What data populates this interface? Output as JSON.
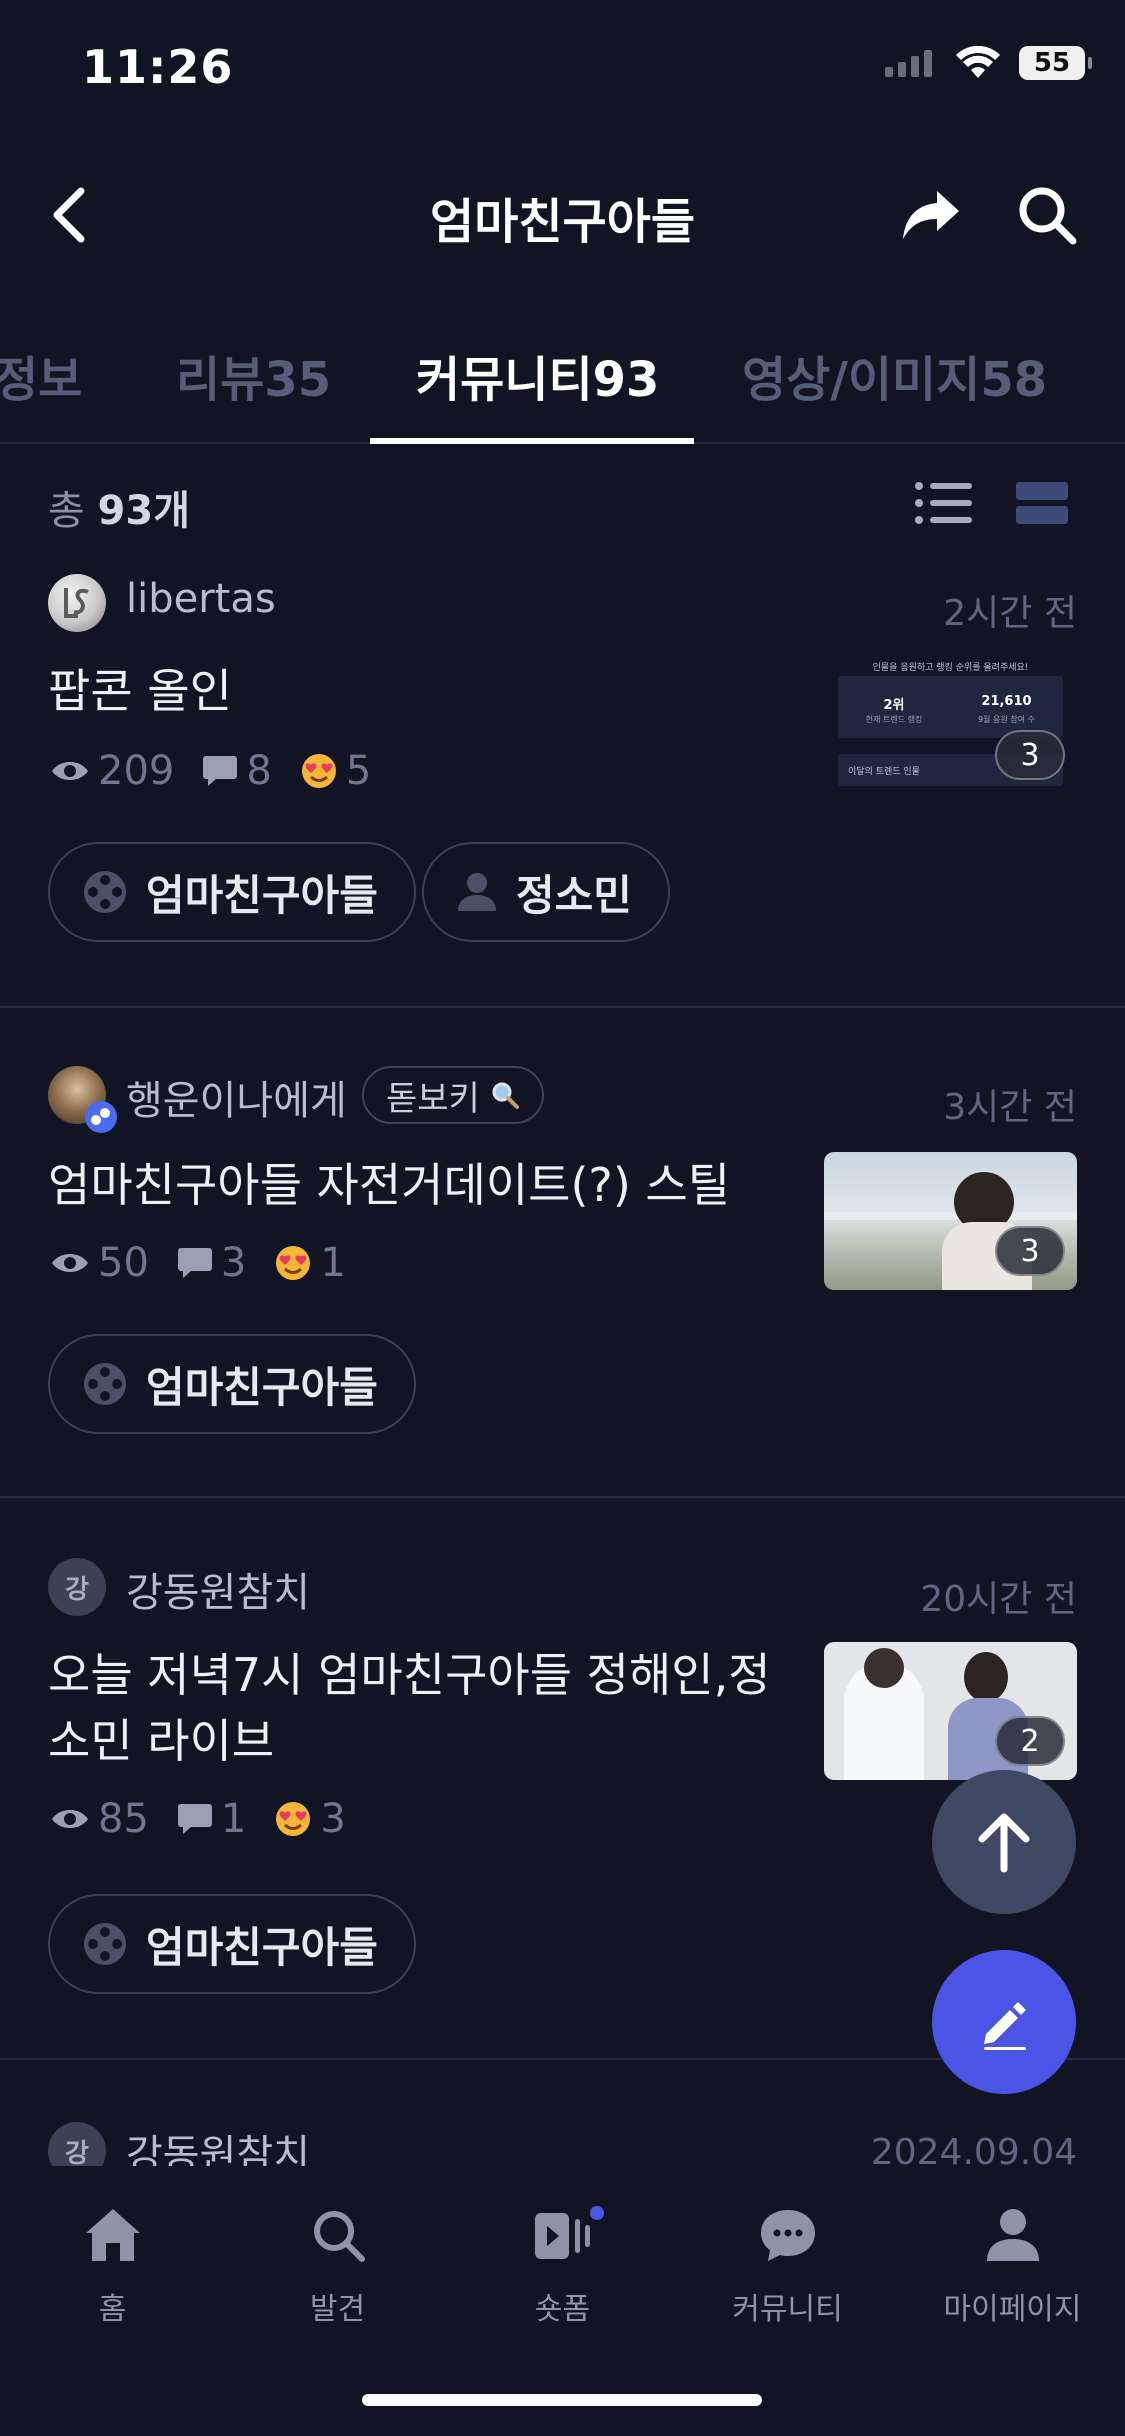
{
  "status_bar": {
    "time": "11:26",
    "battery": "55",
    "icons": [
      "signal-icon",
      "wifi-icon",
      "battery-icon"
    ]
  },
  "header": {
    "title": "엄마친구아들",
    "icons": [
      "back-icon",
      "share-icon",
      "search-icon"
    ]
  },
  "tabs": [
    {
      "label": "정보"
    },
    {
      "label": "리뷰35"
    },
    {
      "label": "커뮤니티93",
      "active": true
    },
    {
      "label": "영상/이미지58"
    }
  ],
  "list_header": {
    "prefix": "총",
    "count": "93개"
  },
  "posts": [
    {
      "author": "libertas",
      "time": "2시간 전",
      "title": "팝콘 올인",
      "views": "209",
      "comments": "8",
      "reactions": "5",
      "image_count": "3",
      "thumb_text": {
        "banner": "인물을 응원하고 랭킹 순위를 올려주세요!",
        "rank": "2위",
        "rank_sub": "현재 트렌드 랭킹",
        "votes": "21,610",
        "votes_sub": "9월 응원 참여 수",
        "footer": "이달의 트렌드 인물"
      },
      "tags": [
        {
          "label": "엄마친구아들",
          "icon": "film-reel-icon"
        },
        {
          "label": "정소민",
          "icon": "person-icon"
        }
      ]
    },
    {
      "author": "행운이나에게",
      "badge": "돋보키",
      "time": "3시간 전",
      "title": "엄마친구아들 자전거데이트(?) 스틸",
      "views": "50",
      "comments": "3",
      "reactions": "1",
      "image_count": "3",
      "tags": [
        {
          "label": "엄마친구아들",
          "icon": "film-reel-icon"
        }
      ]
    },
    {
      "author": "강동원참치",
      "avatar_initial": "강",
      "time": "20시간 전",
      "title": "오늘 저녁7시 엄마친구아들 정해인,정소민 라이브",
      "views": "85",
      "comments": "1",
      "reactions": "3",
      "image_count": "2",
      "tags": [
        {
          "label": "엄마친구아들",
          "icon": "film-reel-icon"
        }
      ]
    },
    {
      "author": "강동원참치",
      "avatar_initial": "강",
      "time": "2024.09.04"
    }
  ],
  "bottom_nav": [
    {
      "label": "홈",
      "icon": "home-icon"
    },
    {
      "label": "발견",
      "icon": "search-icon"
    },
    {
      "label": "숏폼",
      "icon": "shortform-icon",
      "dot": true
    },
    {
      "label": "커뮤니티",
      "icon": "chat-bubble-icon"
    },
    {
      "label": "마이페이지",
      "icon": "person-icon"
    }
  ],
  "colors": {
    "background": "#111422",
    "accent": "#4a55e6",
    "divider": "#262a3d",
    "muted": "#6f7790"
  }
}
